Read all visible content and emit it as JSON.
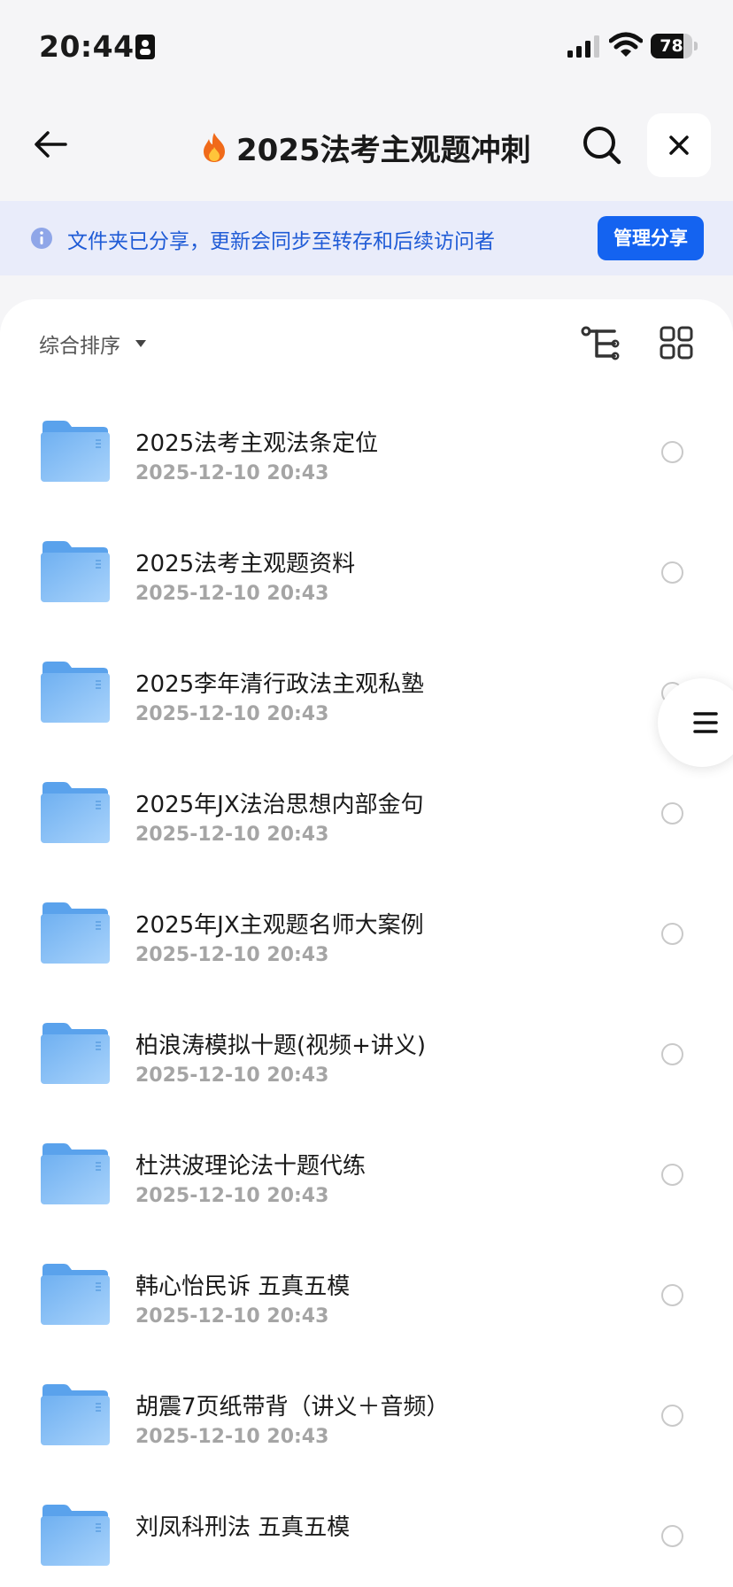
{
  "status_bar": {
    "time": "20:44",
    "battery": "78",
    "battery_level": 0.78
  },
  "header": {
    "title": "2025法考主观题冲刺"
  },
  "banner": {
    "message": "文件夹已分享，更新会同步至转存和后续访问者",
    "manage_label": "管理分享"
  },
  "toolbar": {
    "sort_label": "综合排序"
  },
  "files": [
    {
      "name": "",
      "date": "2025-12-10 20:43"
    },
    {
      "name": "2025法考主观法条定位",
      "date": "2025-12-10 20:43"
    },
    {
      "name": "2025法考主观题资料",
      "date": "2025-12-10 20:43"
    },
    {
      "name": "2025李年清行政法主观私塾",
      "date": "2025-12-10 20:43"
    },
    {
      "name": "2025年JX法治思想内部金句",
      "date": "2025-12-10 20:43"
    },
    {
      "name": "2025年JX主观题名师大案例",
      "date": "2025-12-10 20:43"
    },
    {
      "name": "柏浪涛模拟十题(视频+讲义)",
      "date": "2025-12-10 20:43"
    },
    {
      "name": "杜洪波理论法十题代练",
      "date": "2025-12-10 20:43"
    },
    {
      "name": "韩心怡民诉 五真五模",
      "date": "2025-12-10 20:43"
    },
    {
      "name": "胡震7页纸带背（讲义＋音频）",
      "date": "2025-12-10 20:43"
    },
    {
      "name": "刘凤科刑法 五真五模",
      "date": ""
    }
  ],
  "colors": {
    "accent": "#1463f0",
    "banner_bg": "#e9ecfa",
    "banner_text": "#1f5bd6",
    "folder": "#7fbaf3"
  }
}
